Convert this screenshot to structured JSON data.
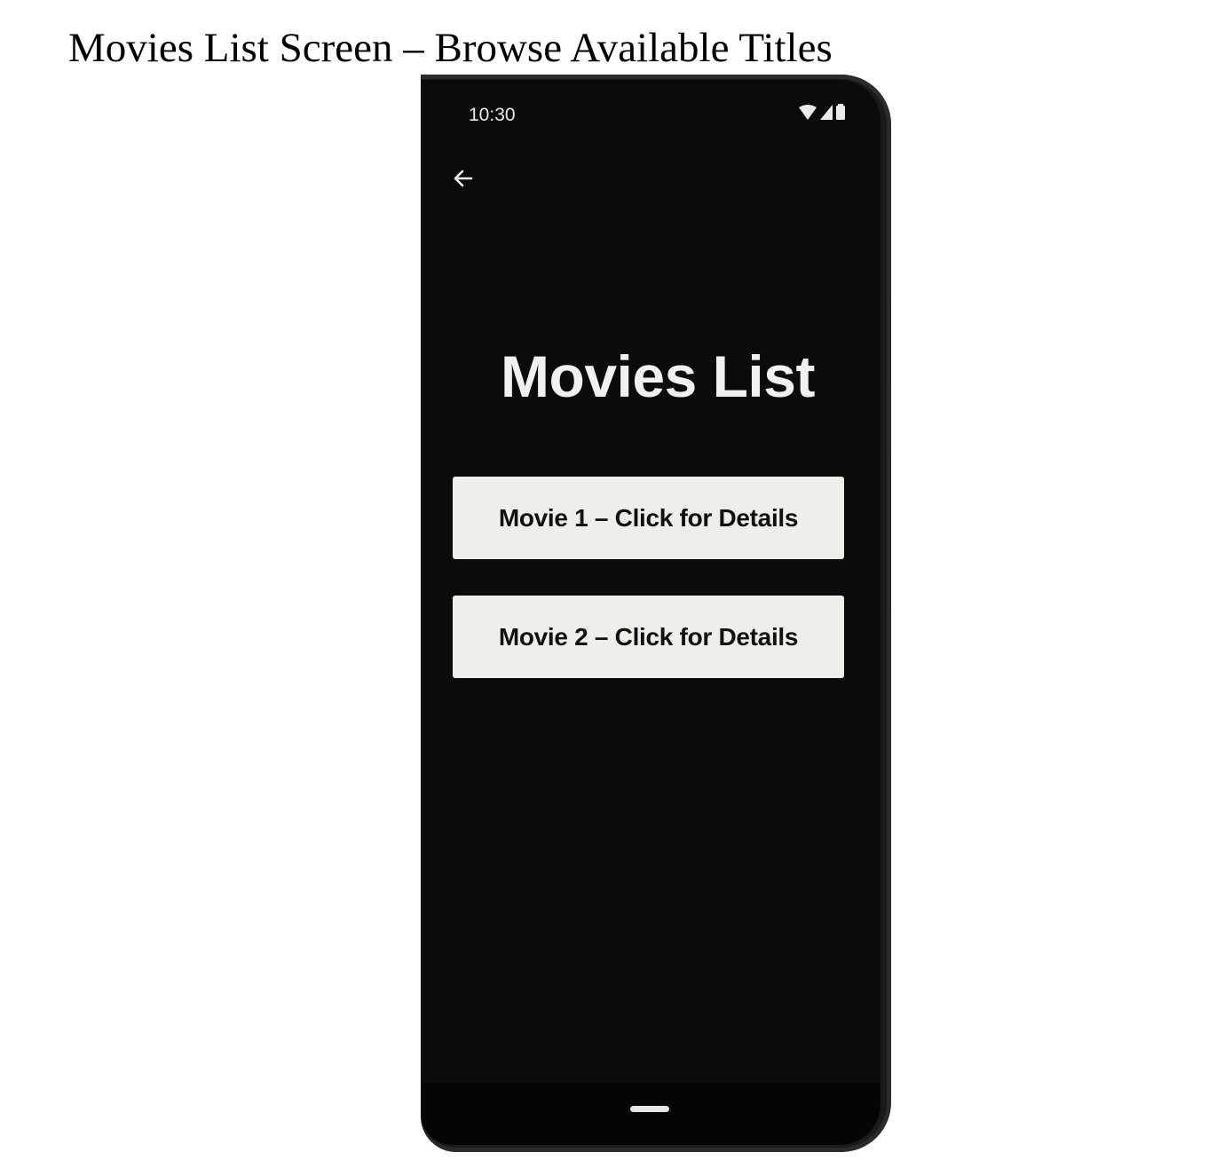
{
  "caption": "Movies List Screen – Browse Available Titles",
  "status_bar": {
    "time": "10:30",
    "icons": [
      "wifi-icon",
      "signal-icon",
      "battery-icon"
    ]
  },
  "toolbar": {
    "back_icon": "arrow-left-icon"
  },
  "screen": {
    "title": "Movies List",
    "movies": [
      {
        "label": "Movie 1 – Click for Details"
      },
      {
        "label": "Movie 2 – Click for Details"
      }
    ]
  },
  "colors": {
    "screen_background": "#0b0b0b",
    "title_text": "#f1f1f1",
    "button_background": "#efeeeb",
    "button_text": "#111111",
    "device_frame": "#1a1a1a"
  }
}
